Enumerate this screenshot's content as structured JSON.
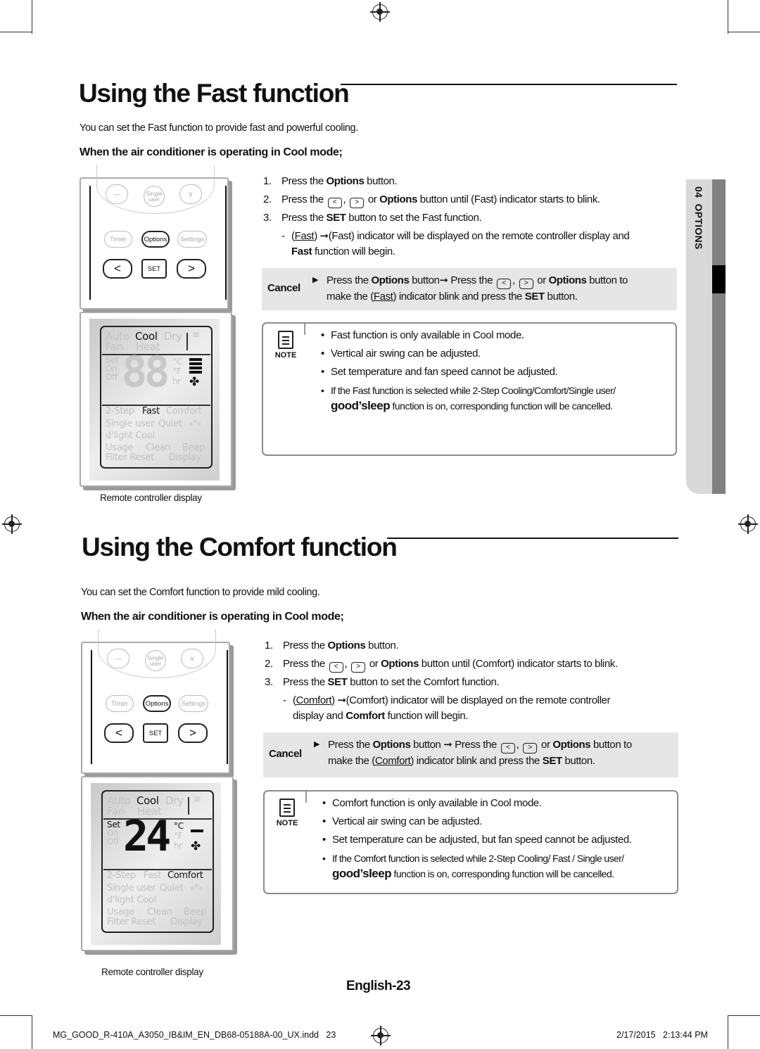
{
  "side_tab": {
    "label": "04  OPTIONS"
  },
  "sections": [
    {
      "title": "Using the Fast function",
      "intro": "You can set the Fast function to provide fast and powerful cooling.",
      "subheading": "When the air conditioner is operating in Cool mode;",
      "steps": [
        {
          "num": "1.",
          "segs": [
            [
              "Press the ",
              ""
            ],
            [
              "Options",
              "b"
            ],
            [
              " button.",
              ""
            ]
          ]
        },
        {
          "num": "2.",
          "segs": [
            [
              "Press the ",
              ""
            ],
            [
              "<",
              "icon"
            ],
            [
              ", ",
              ""
            ],
            [
              ">",
              "icon"
            ],
            [
              " or ",
              ""
            ],
            [
              "Options",
              "b"
            ],
            [
              " button until (Fast) indicator starts to blink.",
              ""
            ]
          ]
        },
        {
          "num": "3.",
          "segs": [
            [
              "Press the ",
              ""
            ],
            [
              "SET",
              "b"
            ],
            [
              " button to set the Fast function.",
              ""
            ]
          ]
        }
      ],
      "sub_step": {
        "dash": "-",
        "line1": [
          [
            "(",
            ""
          ],
          [
            "Fast",
            "u"
          ],
          [
            ") ➞(Fast) indicator will be displayed on the remote controller display and",
            ""
          ]
        ],
        "line2": [
          [
            "Fast",
            "b"
          ],
          [
            " function will begin.",
            ""
          ]
        ]
      },
      "cancel": {
        "label": "Cancel",
        "line1": [
          [
            "Press the ",
            ""
          ],
          [
            "Options",
            "b"
          ],
          [
            " button➞ Press the ",
            ""
          ],
          [
            "<",
            "icon"
          ],
          [
            ", ",
            ""
          ],
          [
            ">",
            "icon"
          ],
          [
            " or ",
            ""
          ],
          [
            "Options",
            "b"
          ],
          [
            " button to",
            ""
          ]
        ],
        "line2": [
          [
            "make the (",
            ""
          ],
          [
            "Fast",
            "u"
          ],
          [
            ") indicator blink and press the ",
            ""
          ],
          [
            "SET",
            "b"
          ],
          [
            " button.",
            ""
          ]
        ]
      },
      "note": {
        "label": "NOTE",
        "bullets": [
          [
            [
              "Fast function is only available in Cool mode.",
              ""
            ]
          ],
          [
            [
              "Vertical air swing can be adjusted.",
              ""
            ]
          ],
          [
            [
              "Set temperature and fan speed cannot be adjusted.",
              ""
            ]
          ],
          [
            [
              "If  the Fast function is selected while 2-Step Cooling/Comfort/Single user/",
              ""
            ]
          ]
        ],
        "cont": [
          [
            "good’sleep",
            "gs"
          ],
          [
            " function is on, corresponding function will be cancelled.",
            ""
          ]
        ]
      },
      "caption": "Remote controller display",
      "remote": {
        "top": [
          "—",
          "Single user",
          "∨",
          "Timer",
          "Options",
          "Settings",
          "<",
          "SET",
          ">"
        ],
        "display": {
          "modes": [
            "Auto",
            "Cool",
            "Dry",
            "Fan",
            "Heat"
          ],
          "active_mode": "Cool",
          "left": [
            "Set",
            "On",
            "Off"
          ],
          "units": [
            "°C",
            "°F",
            "hr"
          ],
          "digits": "88",
          "digits_active": false,
          "set_active": false,
          "row1": [
            "2-Step",
            "Fast",
            "Comfort"
          ],
          "active_option": "Fast",
          "row2": [
            "Single user",
            "Quiet"
          ],
          "row3": "d'light Cool",
          "row4": [
            "Usage",
            "Clean",
            "Beep"
          ],
          "row5": [
            "Filter Reset",
            "Display"
          ]
        }
      }
    },
    {
      "title": "Using the Comfort function",
      "intro": "You can set the Comfort function to provide mild cooling.",
      "subheading": "When the air conditioner is operating in Cool mode;",
      "steps": [
        {
          "num": "1.",
          "segs": [
            [
              "Press the ",
              ""
            ],
            [
              "Options",
              "b"
            ],
            [
              " button.",
              ""
            ]
          ]
        },
        {
          "num": "2.",
          "segs": [
            [
              "Press the ",
              ""
            ],
            [
              "<",
              "icon"
            ],
            [
              ", ",
              ""
            ],
            [
              ">",
              "icon"
            ],
            [
              " or ",
              ""
            ],
            [
              "Options",
              "b"
            ],
            [
              " button until (Comfort) indicator starts to blink.",
              ""
            ]
          ]
        },
        {
          "num": "3.",
          "segs": [
            [
              "Press the ",
              ""
            ],
            [
              "SET",
              "b"
            ],
            [
              " button to set the Comfort function.",
              ""
            ]
          ]
        }
      ],
      "sub_step": {
        "dash": "-",
        "line1": [
          [
            "(",
            ""
          ],
          [
            "Comfort",
            "u"
          ],
          [
            ") ➞(Comfort) indicator will be displayed on the remote controller",
            ""
          ]
        ],
        "line2": [
          [
            "display and ",
            ""
          ],
          [
            "Comfort",
            "b"
          ],
          [
            " function will begin.",
            ""
          ]
        ]
      },
      "cancel": {
        "label": "Cancel",
        "line1": [
          [
            "Press the ",
            ""
          ],
          [
            "Options",
            "b"
          ],
          [
            " button ➞ Press the ",
            ""
          ],
          [
            "<",
            "icon"
          ],
          [
            ", ",
            ""
          ],
          [
            ">",
            "icon"
          ],
          [
            " or ",
            ""
          ],
          [
            "Options",
            "b"
          ],
          [
            " button to",
            ""
          ]
        ],
        "line2": [
          [
            "make the (",
            ""
          ],
          [
            "Comfort",
            "u"
          ],
          [
            ") indicator blink and press the ",
            ""
          ],
          [
            "SET",
            "b"
          ],
          [
            " button.",
            ""
          ]
        ]
      },
      "note": {
        "label": "NOTE",
        "bullets": [
          [
            [
              "Comfort function is only available in Cool mode.",
              ""
            ]
          ],
          [
            [
              "Vertical air swing can be adjusted.",
              ""
            ]
          ],
          [
            [
              "Set temperature can be adjusted, but fan speed cannot be adjusted.",
              ""
            ]
          ],
          [
            [
              "If the Comfort function is selected while 2-Step Cooling/ Fast / Single user/",
              ""
            ]
          ]
        ],
        "cont": [
          [
            "good’sleep",
            "gs"
          ],
          [
            " function is on, corresponding function will be cancelled.",
            ""
          ]
        ]
      },
      "caption": "Remote controller display",
      "remote": {
        "top": [
          "—",
          "Single user",
          "∨",
          "Timer",
          "Options",
          "Settings",
          "<",
          "SET",
          ">"
        ],
        "display": {
          "modes": [
            "Auto",
            "Cool",
            "Dry",
            "Fan",
            "Heat"
          ],
          "active_mode": "Cool",
          "left": [
            "Set",
            "On",
            "Off"
          ],
          "units": [
            "°C",
            "°F",
            "hr"
          ],
          "digits": "24",
          "digits_active": true,
          "set_active": true,
          "row1": [
            "2-Step",
            "Fast",
            "Comfort"
          ],
          "active_option": "Comfort",
          "row2": [
            "Single user",
            "Quiet"
          ],
          "row3": "d'light Cool",
          "row4": [
            "Usage",
            "Clean",
            "Beep"
          ],
          "row5": [
            "Filter Reset",
            "Display"
          ]
        }
      }
    }
  ],
  "page_number": "English-23",
  "footer": {
    "file": "MG_GOOD_R-410A_A3050_IB&IM_EN_DB68-05188A-00_UX.indd   23",
    "date": "2/17/2015   2:13:44 PM"
  }
}
